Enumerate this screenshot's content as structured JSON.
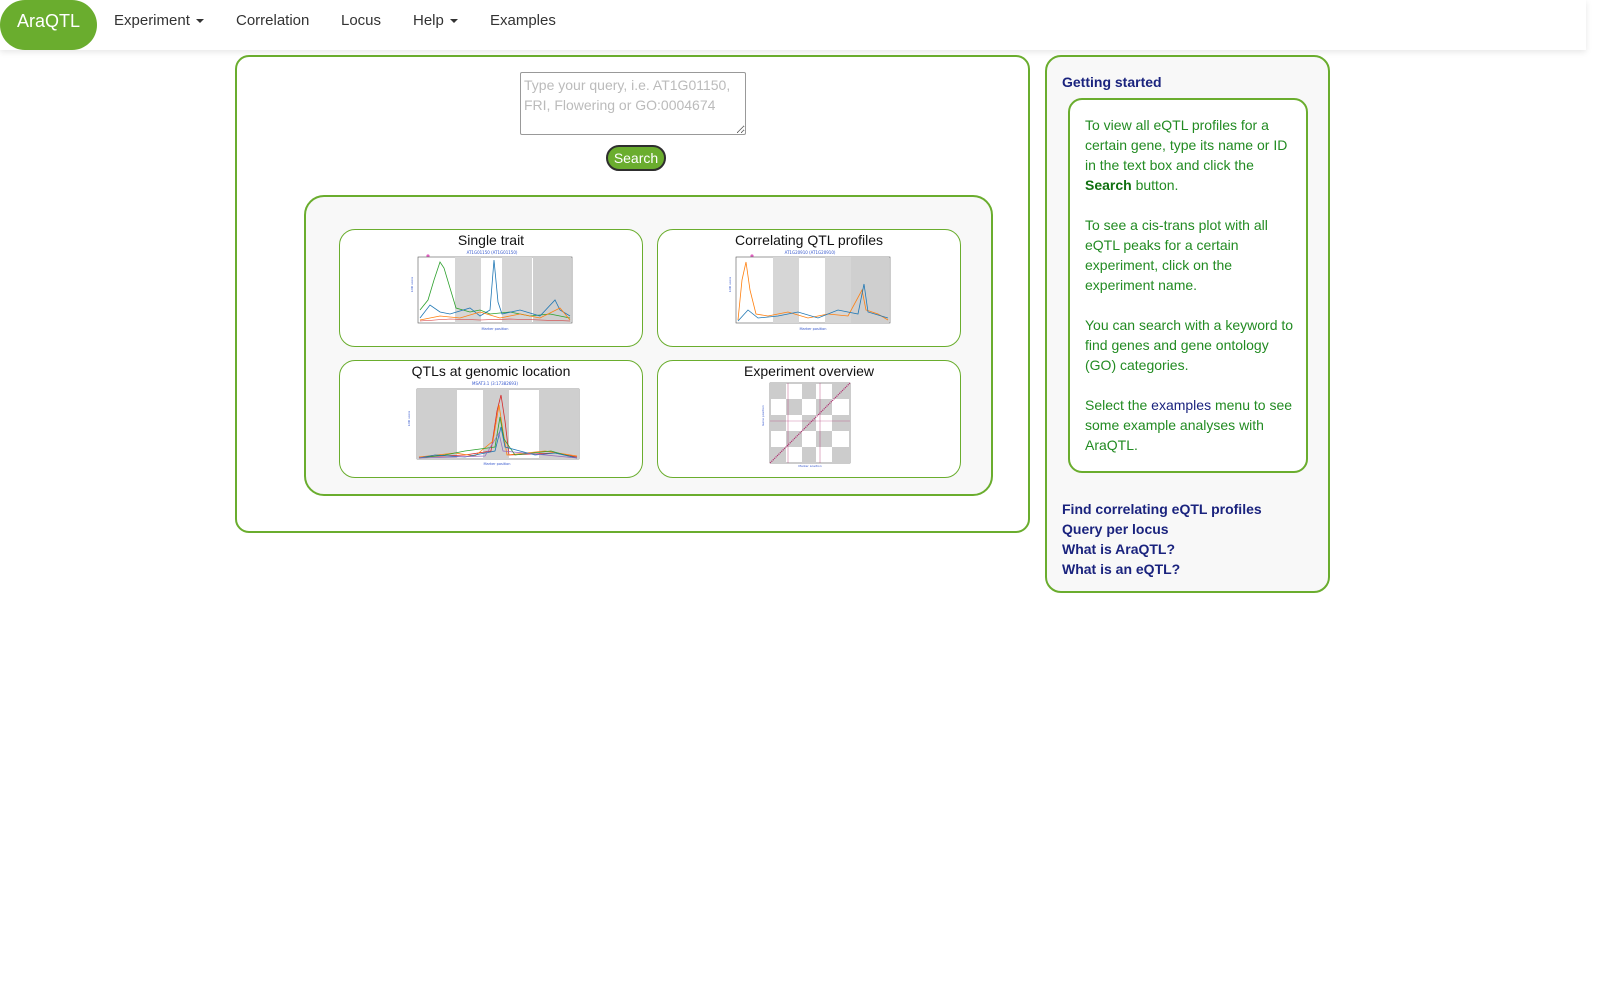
{
  "navbar": {
    "brand": "AraQTL",
    "items": [
      {
        "label": "Experiment",
        "dropdown": true
      },
      {
        "label": "Correlation",
        "dropdown": false
      },
      {
        "label": "Locus",
        "dropdown": false
      },
      {
        "label": "Help",
        "dropdown": true
      },
      {
        "label": "Examples",
        "dropdown": false
      }
    ]
  },
  "search": {
    "placeholder": "Type your query, i.e. AT1G01150, FRI, Flowering or GO:0004674",
    "value": "",
    "button_label": "Search"
  },
  "cards": [
    {
      "title": "Single trait",
      "thumbnail": "single-trait-eqtl-plot"
    },
    {
      "title": "Correlating QTL profiles",
      "thumbnail": "correlating-profiles-plot"
    },
    {
      "title": "QTLs at genomic location",
      "thumbnail": "genomic-location-plot"
    },
    {
      "title": "Experiment overview",
      "thumbnail": "cis-trans-overview-plot"
    }
  ],
  "sidebar": {
    "heading": "Getting started",
    "help": {
      "p1_text": "To view all eQTL profiles for a certain gene, type its name or ID in the text box and click the",
      "p1_bold": "Search",
      "p1_after": "button.",
      "p2": "To see a cis-trans plot with all eQTL peaks for a certain experiment, click on the experiment name.",
      "p3": "You can search with a keyword to find genes and gene ontology (GO) categories.",
      "p4_before": "Select the",
      "p4_link": "examples",
      "p4_after": "menu to see some example analyses with AraQTL."
    },
    "links": [
      "Find correlating eQTL profiles",
      "Query per locus",
      "What is AraQTL?",
      "What is an eQTL?"
    ]
  },
  "colors": {
    "brand_green": "#6aad2e",
    "link_navy": "#1a237e",
    "help_text_green": "#228b22"
  }
}
